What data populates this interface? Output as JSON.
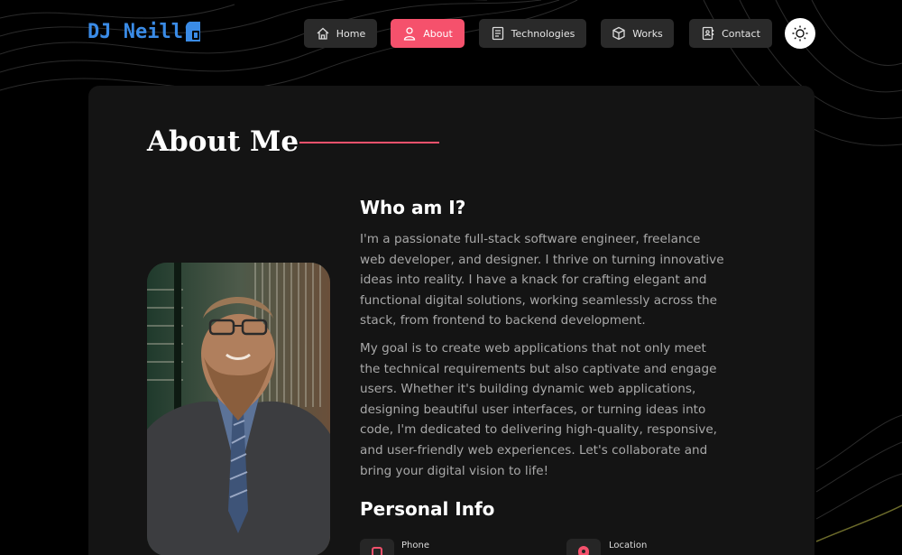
{
  "brand": {
    "name": "DJ Neill",
    "accent": "#3a8be6"
  },
  "nav": {
    "items": [
      {
        "label": "Home",
        "icon": "home-icon"
      },
      {
        "label": "About",
        "icon": "user-icon",
        "active": true
      },
      {
        "label": "Technologies",
        "icon": "document-icon"
      },
      {
        "label": "Works",
        "icon": "box-icon"
      },
      {
        "label": "Contact",
        "icon": "contact-book-icon"
      }
    ],
    "theme_toggle_icon": "sun-icon",
    "active_color": "#f5516c"
  },
  "about": {
    "title": "About Me",
    "who_heading": "Who am I?",
    "paragraph1": "I'm a passionate full-stack software engineer, freelance web developer, and designer. I thrive on turning innovative ideas into reality. I have a knack for crafting elegant and functional digital solutions, working seamlessly across the stack, from frontend to backend development.",
    "paragraph2": "My goal is to create web applications that not only meet the technical requirements but also captivate and engage users. Whether it's building dynamic web applications, designing beautiful user interfaces, or turning ideas into code, I'm dedicated to delivering high-quality, responsive, and user-friendly web experiences. Let's collaborate and bring your digital vision to life!",
    "personal_info_heading": "Personal Info",
    "info": [
      {
        "label": "Phone",
        "icon": "phone-icon"
      },
      {
        "label": "Location",
        "icon": "location-pin-icon"
      }
    ]
  }
}
